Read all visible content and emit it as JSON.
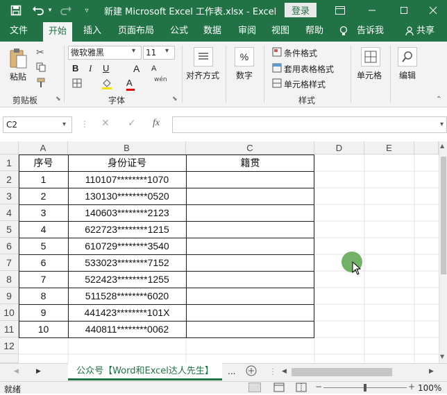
{
  "titlebar": {
    "title": "新建 Microsoft Excel 工作表.xlsx  -  Excel",
    "login": "登录"
  },
  "tabs": [
    "文件",
    "开始",
    "插入",
    "页面布局",
    "公式",
    "数据",
    "审阅",
    "视图",
    "帮助",
    "告诉我",
    "共享"
  ],
  "ribbon": {
    "paste": "粘贴",
    "clipboard": "剪贴板",
    "font_name": "微软雅黑",
    "font_size": "11",
    "font": "字体",
    "bold": "B",
    "italic": "I",
    "underline": "U",
    "grow": "A",
    "shrink": "A",
    "font_color": "A",
    "phonetic": "wén",
    "align": "对齐方式",
    "number": "数字",
    "number_symbol": "%",
    "cond_format": "条件格式",
    "table_format": "套用表格格式",
    "cell_style": "单元格样式",
    "styles": "样式",
    "cells": "单元格",
    "edit": "编辑"
  },
  "formula_bar": {
    "name_box": "C2",
    "fx": "fx",
    "value": ""
  },
  "columns": [
    "A",
    "B",
    "C",
    "D",
    "E"
  ],
  "rows": [
    "1",
    "2",
    "3",
    "4",
    "5",
    "6",
    "7",
    "8",
    "9",
    "10",
    "11",
    "12"
  ],
  "table": {
    "headers": [
      "序号",
      "身份证号",
      "籍贯"
    ],
    "data": [
      [
        "1",
        "110107********1070",
        ""
      ],
      [
        "2",
        "130130********0520",
        ""
      ],
      [
        "3",
        "140603********2123",
        ""
      ],
      [
        "4",
        "622723********1215",
        ""
      ],
      [
        "5",
        "610729********3540",
        ""
      ],
      [
        "6",
        "533023********7152",
        ""
      ],
      [
        "7",
        "522423********1255",
        ""
      ],
      [
        "8",
        "511528********6020",
        ""
      ],
      [
        "9",
        "441423********101X",
        ""
      ],
      [
        "10",
        "440811********0062",
        ""
      ]
    ]
  },
  "sheet_tab": "公众号【Word和Excel达人先生】",
  "sheet_more": "...",
  "status": {
    "ready": "就绪",
    "zoom": "100%"
  },
  "colors": {
    "brand": "#217346",
    "cursor": "#5aa54c"
  }
}
